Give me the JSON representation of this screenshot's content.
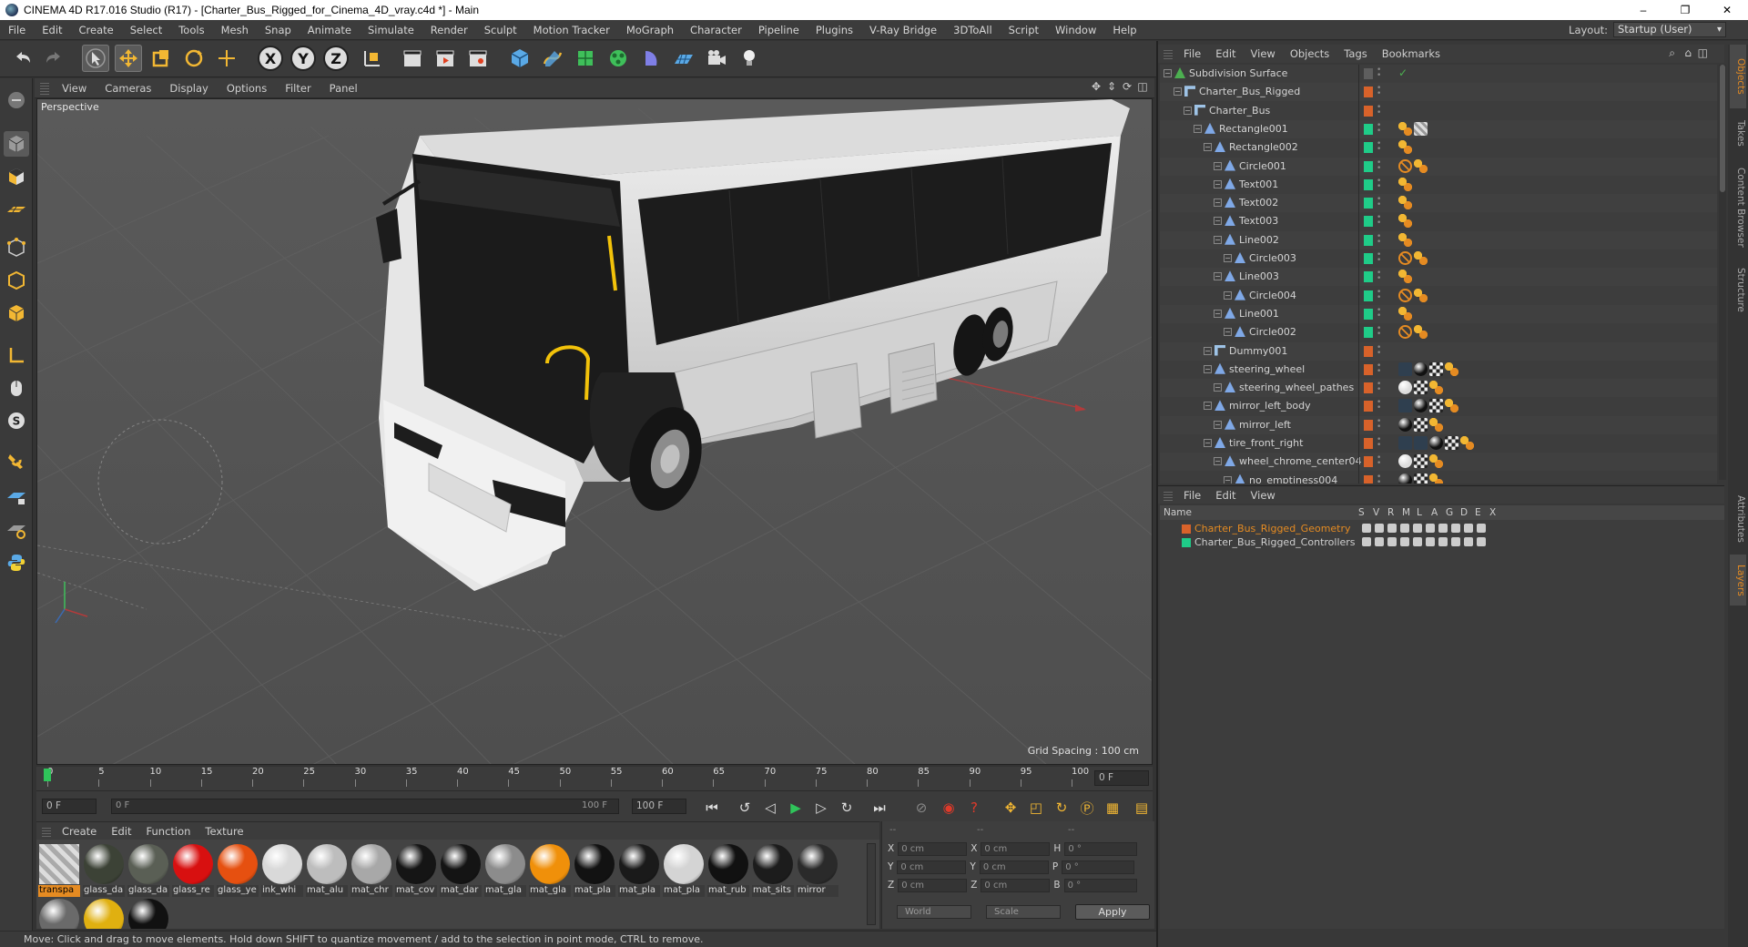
{
  "window": {
    "title": "CINEMA 4D R17.016 Studio (R17) - [Charter_Bus_Rigged_for_Cinema_4D_vray.c4d *] - Main",
    "controls": [
      "–",
      "❐",
      "✕"
    ]
  },
  "menubar": {
    "items": [
      "File",
      "Edit",
      "Create",
      "Select",
      "Tools",
      "Mesh",
      "Snap",
      "Animate",
      "Simulate",
      "Render",
      "Sculpt",
      "Motion Tracker",
      "MoGraph",
      "Character",
      "Pipeline",
      "Plugins",
      "V-Ray Bridge",
      "3DToAll",
      "Script",
      "Window",
      "Help"
    ],
    "layout_label": "Layout:",
    "layout_value": "Startup (User)"
  },
  "toolbar": {
    "axis_x": "X",
    "axis_y": "Y",
    "axis_z": "Z"
  },
  "viewport": {
    "menu": [
      "View",
      "Cameras",
      "Display",
      "Options",
      "Filter",
      "Panel"
    ],
    "camera_label": "Perspective",
    "grid_spacing": "Grid Spacing : 100 cm"
  },
  "timeline": {
    "ticks": [
      "0",
      "5",
      "10",
      "15",
      "20",
      "25",
      "30",
      "35",
      "40",
      "45",
      "50",
      "55",
      "60",
      "65",
      "70",
      "75",
      "80",
      "85",
      "90",
      "95",
      "100"
    ],
    "current_frame": "0 F",
    "start_frame": "0 F",
    "range_start": "0 F",
    "range_end": "100 F",
    "end_frame": "100 F"
  },
  "materials": {
    "menu": [
      "Create",
      "Edit",
      "Function",
      "Texture"
    ],
    "items": [
      {
        "label": "transpa",
        "color": "checker",
        "selected": true
      },
      {
        "label": "glass_da",
        "color": "#3c4236"
      },
      {
        "label": "glass_da",
        "color": "#5a5f55"
      },
      {
        "label": "glass_re",
        "color": "#d81010"
      },
      {
        "label": "glass_ye",
        "color": "#e65010"
      },
      {
        "label": "ink_whi",
        "color": "#d9d9d9"
      },
      {
        "label": "mat_alu",
        "color": "#bdbdbd"
      },
      {
        "label": "mat_chr",
        "color": "#a8a8a8"
      },
      {
        "label": "mat_cov",
        "color": "#151515"
      },
      {
        "label": "mat_dar",
        "color": "#141414"
      },
      {
        "label": "mat_gla",
        "color": "#8c8c8c"
      },
      {
        "label": "mat_gla",
        "color": "#f0900a"
      },
      {
        "label": "mat_pla",
        "color": "#121212"
      },
      {
        "label": "mat_pla",
        "color": "#1a1a1a"
      },
      {
        "label": "mat_pla",
        "color": "#d4d4d4"
      },
      {
        "label": "mat_rub",
        "color": "#111111"
      },
      {
        "label": "mat_sits",
        "color": "#1c1c1c"
      },
      {
        "label": "mirror",
        "color": "#2a2a2a"
      },
      {
        "label": "",
        "color": "#6a6a6a"
      },
      {
        "label": "",
        "color": "#e0b010"
      },
      {
        "label": "",
        "color": "#111111"
      }
    ]
  },
  "coordinates": {
    "header": [
      "--",
      "--",
      "--"
    ],
    "rows": [
      {
        "a": "X",
        "av": "0 cm",
        "b": "X",
        "bv": "0 cm",
        "c": "H",
        "cv": "0 °"
      },
      {
        "a": "Y",
        "av": "0 cm",
        "b": "Y",
        "bv": "0 cm",
        "c": "P",
        "cv": "0 °"
      },
      {
        "a": "Z",
        "av": "0 cm",
        "b": "Z",
        "bv": "0 cm",
        "c": "B",
        "cv": "0 °"
      }
    ],
    "mode": "World",
    "scale": "Scale",
    "apply": "Apply"
  },
  "statusbar": {
    "text": "Move: Click and drag to move elements. Hold down SHIFT to quantize movement / add to the selection in point mode, CTRL to remove."
  },
  "objects_panel": {
    "menu": [
      "File",
      "Edit",
      "View",
      "Objects",
      "Tags",
      "Bookmarks"
    ],
    "rows": [
      {
        "name": "Subdivision Surface",
        "depth": 0,
        "type": "sds",
        "layer": "#5e5e5e",
        "tags": [
          "check"
        ]
      },
      {
        "name": "Charter_Bus_Rigged",
        "depth": 1,
        "type": "null",
        "layer": "#d8622a",
        "tags": []
      },
      {
        "name": "Charter_Bus",
        "depth": 2,
        "type": "null",
        "layer": "#d8622a",
        "tags": []
      },
      {
        "name": "Rectangle001",
        "depth": 3,
        "type": "spline",
        "layer": "#1fcc88",
        "tags": [
          "ik",
          "tex"
        ]
      },
      {
        "name": "Rectangle002",
        "depth": 4,
        "type": "spline",
        "layer": "#1fcc88",
        "tags": [
          "ik"
        ]
      },
      {
        "name": "Circle001",
        "depth": 5,
        "type": "spline",
        "layer": "#1fcc88",
        "tags": [
          "noent",
          "ik"
        ]
      },
      {
        "name": "Text001",
        "depth": 5,
        "type": "spline",
        "layer": "#1fcc88",
        "tags": [
          "ik"
        ]
      },
      {
        "name": "Text002",
        "depth": 5,
        "type": "spline",
        "layer": "#1fcc88",
        "tags": [
          "ik"
        ]
      },
      {
        "name": "Text003",
        "depth": 5,
        "type": "spline",
        "layer": "#1fcc88",
        "tags": [
          "ik"
        ]
      },
      {
        "name": "Line002",
        "depth": 5,
        "type": "spline",
        "layer": "#1fcc88",
        "tags": [
          "ik"
        ]
      },
      {
        "name": "Circle003",
        "depth": 6,
        "type": "spline",
        "layer": "#1fcc88",
        "tags": [
          "noent",
          "ik"
        ]
      },
      {
        "name": "Line003",
        "depth": 5,
        "type": "spline",
        "layer": "#1fcc88",
        "tags": [
          "ik"
        ]
      },
      {
        "name": "Circle004",
        "depth": 6,
        "type": "spline",
        "layer": "#1fcc88",
        "tags": [
          "noent",
          "ik"
        ]
      },
      {
        "name": "Line001",
        "depth": 5,
        "type": "spline",
        "layer": "#1fcc88",
        "tags": [
          "ik"
        ]
      },
      {
        "name": "Circle002",
        "depth": 6,
        "type": "spline",
        "layer": "#1fcc88",
        "tags": [
          "noent",
          "ik"
        ]
      },
      {
        "name": "Dummy001",
        "depth": 4,
        "type": "null",
        "layer": "#d8622a",
        "tags": []
      },
      {
        "name": "steering_wheel",
        "depth": 4,
        "type": "poly",
        "layer": "#d8622a",
        "tags": [
          "phong",
          "black",
          "chk",
          "ik"
        ]
      },
      {
        "name": "steering_wheel_pathes",
        "depth": 5,
        "type": "poly",
        "layer": "#d8622a",
        "tags": [
          "white",
          "chk",
          "ik"
        ]
      },
      {
        "name": "mirror_left_body",
        "depth": 4,
        "type": "poly",
        "layer": "#d8622a",
        "tags": [
          "phong",
          "black",
          "chk",
          "ik"
        ]
      },
      {
        "name": "mirror_left",
        "depth": 5,
        "type": "poly",
        "layer": "#d8622a",
        "tags": [
          "black",
          "chk",
          "ik"
        ]
      },
      {
        "name": "tire_front_right",
        "depth": 4,
        "type": "poly",
        "layer": "#d8622a",
        "tags": [
          "phong",
          "phong",
          "black",
          "chk",
          "ik"
        ]
      },
      {
        "name": "wheel_chrome_center04",
        "depth": 5,
        "type": "poly",
        "layer": "#d8622a",
        "tags": [
          "white",
          "chk",
          "ik"
        ]
      },
      {
        "name": "no_emptiness004",
        "depth": 6,
        "type": "poly",
        "layer": "#d8622a",
        "tags": [
          "black",
          "chk",
          "ik"
        ]
      }
    ]
  },
  "layers_panel": {
    "menu": [
      "File",
      "Edit",
      "View"
    ],
    "columns": [
      "Name",
      "S",
      "V",
      "R",
      "M",
      "L",
      "A",
      "G",
      "D",
      "E",
      "X"
    ],
    "rows": [
      {
        "name": "Charter_Bus_Rigged_Geometry",
        "color": "#d8622a",
        "text_color": "#e58b22"
      },
      {
        "name": "Charter_Bus_Rigged_Controllers",
        "color": "#1fcc88",
        "text_color": "#d4d4d4"
      }
    ]
  },
  "side_tabs": [
    "Objects",
    "Takes",
    "Content Browser",
    "Structure",
    "Attributes",
    "Layers"
  ]
}
